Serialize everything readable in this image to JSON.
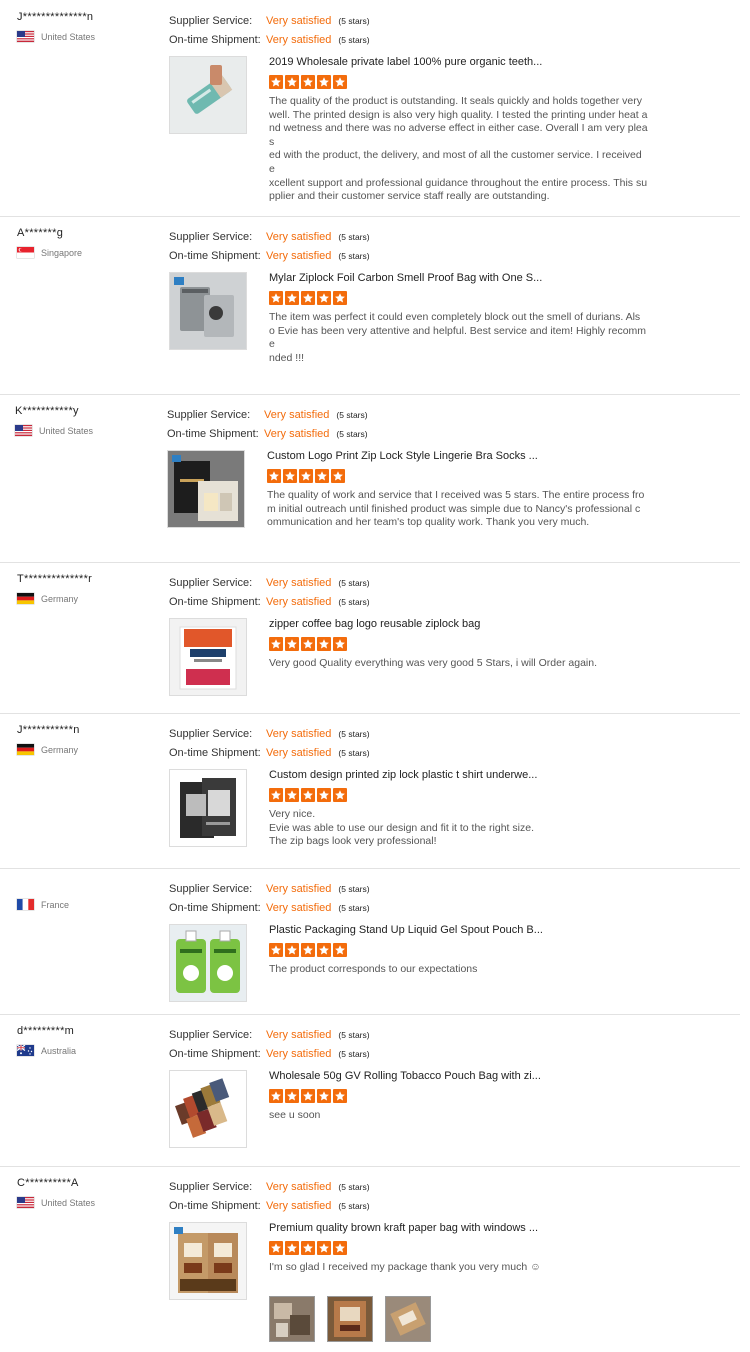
{
  "labels": {
    "supplier_service": "Supplier Service:",
    "ontime_shipment": "On-time Shipment:"
  },
  "colors": {
    "accent": "#f36c0c",
    "divider": "#e2e2e2"
  },
  "reviews": [
    {
      "buyer": "J**************n",
      "country": "United States",
      "flag_icon": "us-flag-icon",
      "supplier_rating": "Very satisfied",
      "supplier_stars": "(5 stars)",
      "shipment_rating": "Very satisfied",
      "shipment_stars": "(5 stars)",
      "product_title": "2019 Wholesale private label 100% pure organic teeth...",
      "product_stars": 5,
      "comment": "The quality of the product is outstanding. It seals quickly and holds together very\nwell. The printed design is also very high quality. I tested the printing under heat a\nnd wetness and there was no adverse effect in either case. Overall I am very pleas\ned with the product, the delivery, and most of all the customer service. I received e\nxcellent support and professional guidance throughout the entire process. This su\npplier and their customer service staff really are outstanding."
    },
    {
      "buyer": "A*******g",
      "country": "Singapore",
      "flag_icon": "singapore-flag-icon",
      "supplier_rating": "Very satisfied",
      "supplier_stars": "(5 stars)",
      "shipment_rating": "Very satisfied",
      "shipment_stars": "(5 stars)",
      "product_title": "Mylar Ziplock Foil Carbon Smell Proof Bag with One S...",
      "product_stars": 5,
      "comment": "The item was perfect it could even completely block out the smell of durians. Als\no Evie has been very attentive and helpful. Best service and item! Highly recomme\nnded !!!"
    },
    {
      "buyer": "K***********y",
      "country": "United States",
      "flag_icon": "us-flag-icon",
      "supplier_rating": "Very satisfied",
      "supplier_stars": "(5 stars)",
      "shipment_rating": "Very satisfied",
      "shipment_stars": "(5 stars)",
      "product_title": "Custom Logo Print Zip Lock Style Lingerie Bra Socks ...",
      "product_stars": 5,
      "comment": "The quality of work and service that I received was 5 stars. The entire process fro\nm initial outreach until finished product was simple due to Nancy's professional c\nommunication and her team's top quality work. Thank you very much."
    },
    {
      "buyer": "T**************r",
      "country": "Germany",
      "flag_icon": "germany-flag-icon",
      "supplier_rating": "Very satisfied",
      "supplier_stars": "(5 stars)",
      "shipment_rating": "Very satisfied",
      "shipment_stars": "(5 stars)",
      "product_title": "zipper coffee bag logo reusable ziplock bag",
      "product_stars": 5,
      "comment": "Very good Quality everything was very good 5 Stars, i will Order again."
    },
    {
      "buyer": "J***********n",
      "country": "Germany",
      "flag_icon": "germany-flag-icon",
      "supplier_rating": "Very satisfied",
      "supplier_stars": "(5 stars)",
      "shipment_rating": "Very satisfied",
      "shipment_stars": "(5 stars)",
      "product_title": "Custom design printed zip lock plastic t shirt underwe...",
      "product_stars": 5,
      "comment": "Very nice.\nEvie was able to use our design and fit it to the right size.\nThe zip bags look very professional!"
    },
    {
      "buyer": "",
      "country": "France",
      "flag_icon": "france-flag-icon",
      "supplier_rating": "Very satisfied",
      "supplier_stars": "(5 stars)",
      "shipment_rating": "Very satisfied",
      "shipment_stars": "(5 stars)",
      "product_title": "Plastic Packaging Stand Up Liquid Gel Spout Pouch B...",
      "product_stars": 5,
      "comment": "The product corresponds to our expectations"
    },
    {
      "buyer": "d*********m",
      "country": "Australia",
      "flag_icon": "australia-flag-icon",
      "supplier_rating": "Very satisfied",
      "supplier_stars": "(5 stars)",
      "shipment_rating": "Very satisfied",
      "shipment_stars": "(5 stars)",
      "product_title": "Wholesale 50g GV Rolling Tobacco Pouch Bag with zi...",
      "product_stars": 5,
      "comment": "see u soon"
    },
    {
      "buyer": "C**********A",
      "country": "United States",
      "flag_icon": "us-flag-icon",
      "supplier_rating": "Very satisfied",
      "supplier_stars": "(5 stars)",
      "shipment_rating": "Very satisfied",
      "shipment_stars": "(5 stars)",
      "product_title": "Premium quality brown kraft paper bag with windows ...",
      "product_stars": 5,
      "comment": "I'm so glad I received my package thank you very much ☺",
      "photos": [
        "review-photo-1",
        "review-photo-2",
        "review-photo-3"
      ]
    }
  ]
}
